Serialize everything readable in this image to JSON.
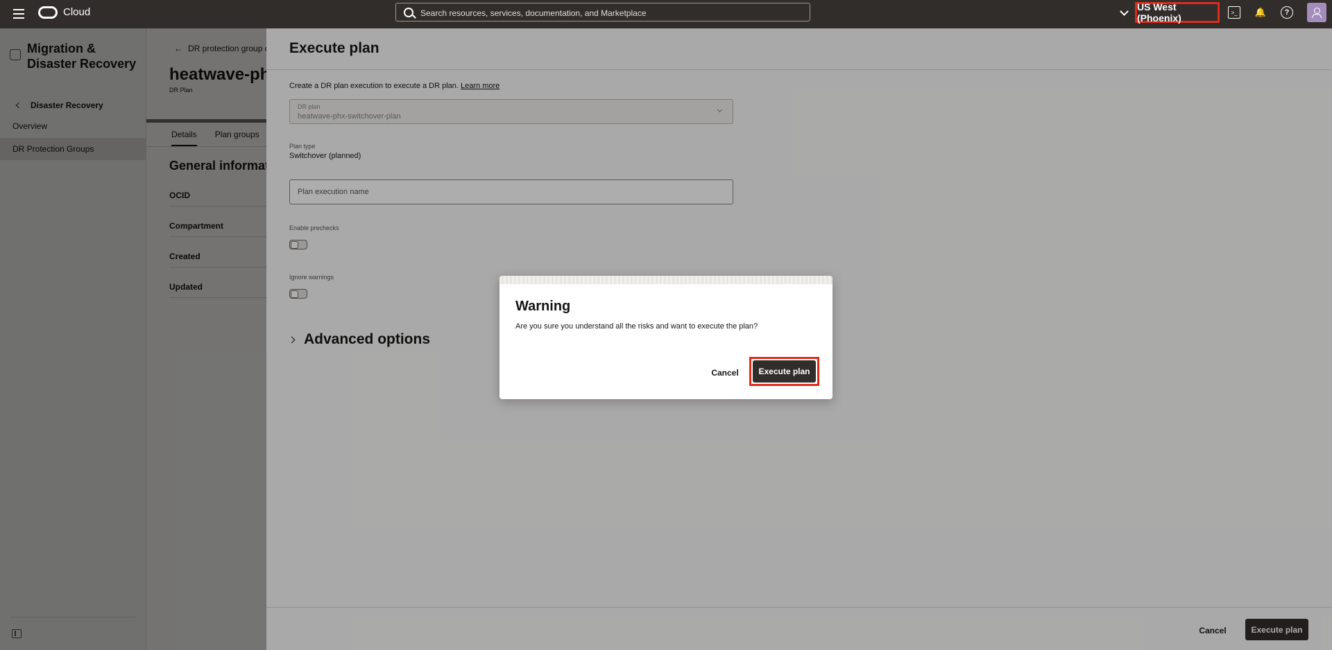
{
  "topbar": {
    "brand": "Cloud",
    "search_placeholder": "Search resources, services, documentation, and Marketplace",
    "region": "US West (Phoenix)",
    "icons": [
      "menu-icon",
      "oracle-logo",
      "search-icon",
      "chevron-down-icon",
      "cloud-shell-icon",
      "bell-icon",
      "help-icon",
      "user-icon"
    ],
    "highlight_color": "#e0291b"
  },
  "leftnav": {
    "title": "Migration & Disaster Recovery",
    "back_label": "Disaster Recovery",
    "items": [
      {
        "label": "Overview",
        "active": false
      },
      {
        "label": "DR Protection Groups",
        "active": true
      }
    ]
  },
  "detail": {
    "breadcrumb": "DR protection group d",
    "title": "heatwave-ph",
    "subtitle": "DR Plan",
    "tabs": [
      "Details",
      "Plan groups"
    ],
    "section_title": "General informati",
    "labels": [
      "OCID",
      "Compartment",
      "Created",
      "Updated"
    ]
  },
  "panel": {
    "title": "Execute plan",
    "description": "Create a DR plan execution to execute a DR plan.",
    "learn_more": "Learn more",
    "dr_plan_label": "DR plan",
    "dr_plan_value": "heatwave-phx-switchover-plan",
    "plan_type_label": "Plan type",
    "plan_type_value": "Switchover (planned)",
    "name_placeholder": "Plan execution name",
    "prechecks_label": "Enable prechecks",
    "prechecks_on": false,
    "ignore_label": "Ignore warnings",
    "ignore_on": false,
    "advanced_label": "Advanced options",
    "cancel_label": "Cancel",
    "execute_label": "Execute plan"
  },
  "modal": {
    "title": "Warning",
    "body": "Are you sure you understand all the risks and want to execute the plan?",
    "cancel_label": "Cancel",
    "execute_label": "Execute plan"
  }
}
